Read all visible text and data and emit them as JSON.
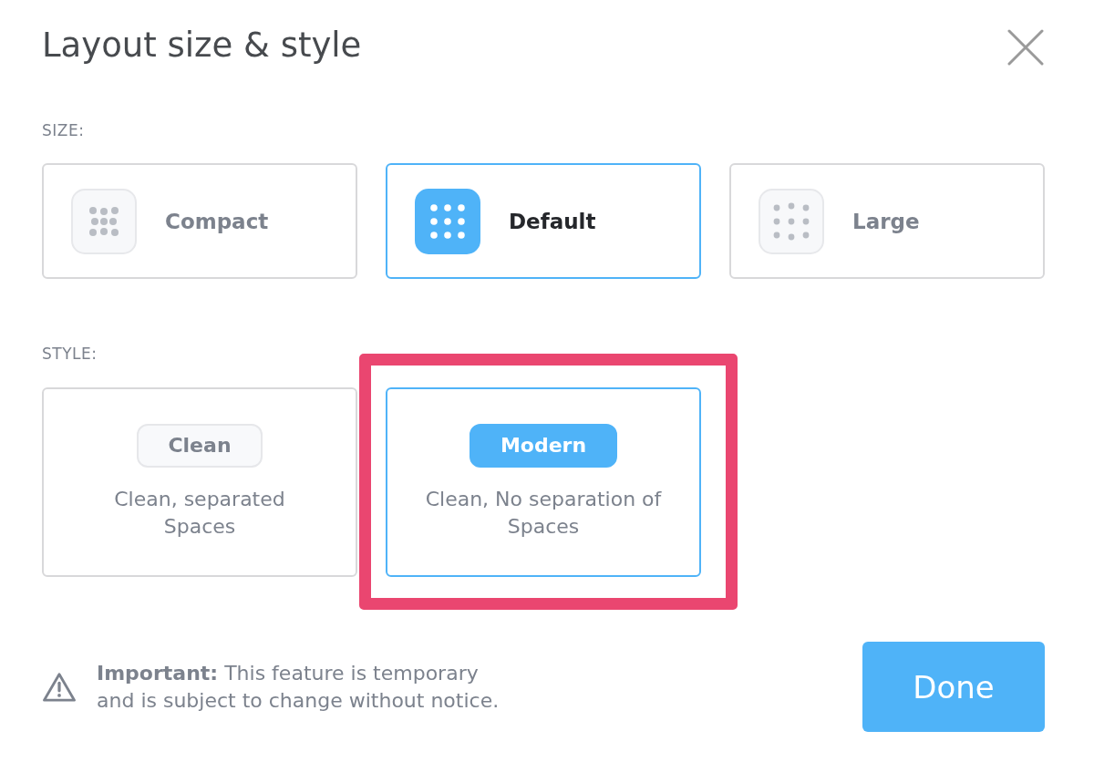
{
  "dialog": {
    "title": "Layout size & style"
  },
  "size_section": {
    "label": "SIZE:",
    "options": [
      {
        "label": "Compact",
        "kind": "compact",
        "selected": false
      },
      {
        "label": "Default",
        "kind": "default",
        "selected": true
      },
      {
        "label": "Large",
        "kind": "large",
        "selected": false
      }
    ]
  },
  "style_section": {
    "label": "STYLE:",
    "options": [
      {
        "label": "Clean",
        "description": "Clean, separated Spaces",
        "selected": false,
        "highlighted": false
      },
      {
        "label": "Modern",
        "description": "Clean, No separation of Spaces",
        "selected": true,
        "highlighted": true
      }
    ]
  },
  "notice": {
    "text": "**Important:** This feature is temporary and is subject to change without notice."
  },
  "done_button": {
    "label": "Done"
  }
}
